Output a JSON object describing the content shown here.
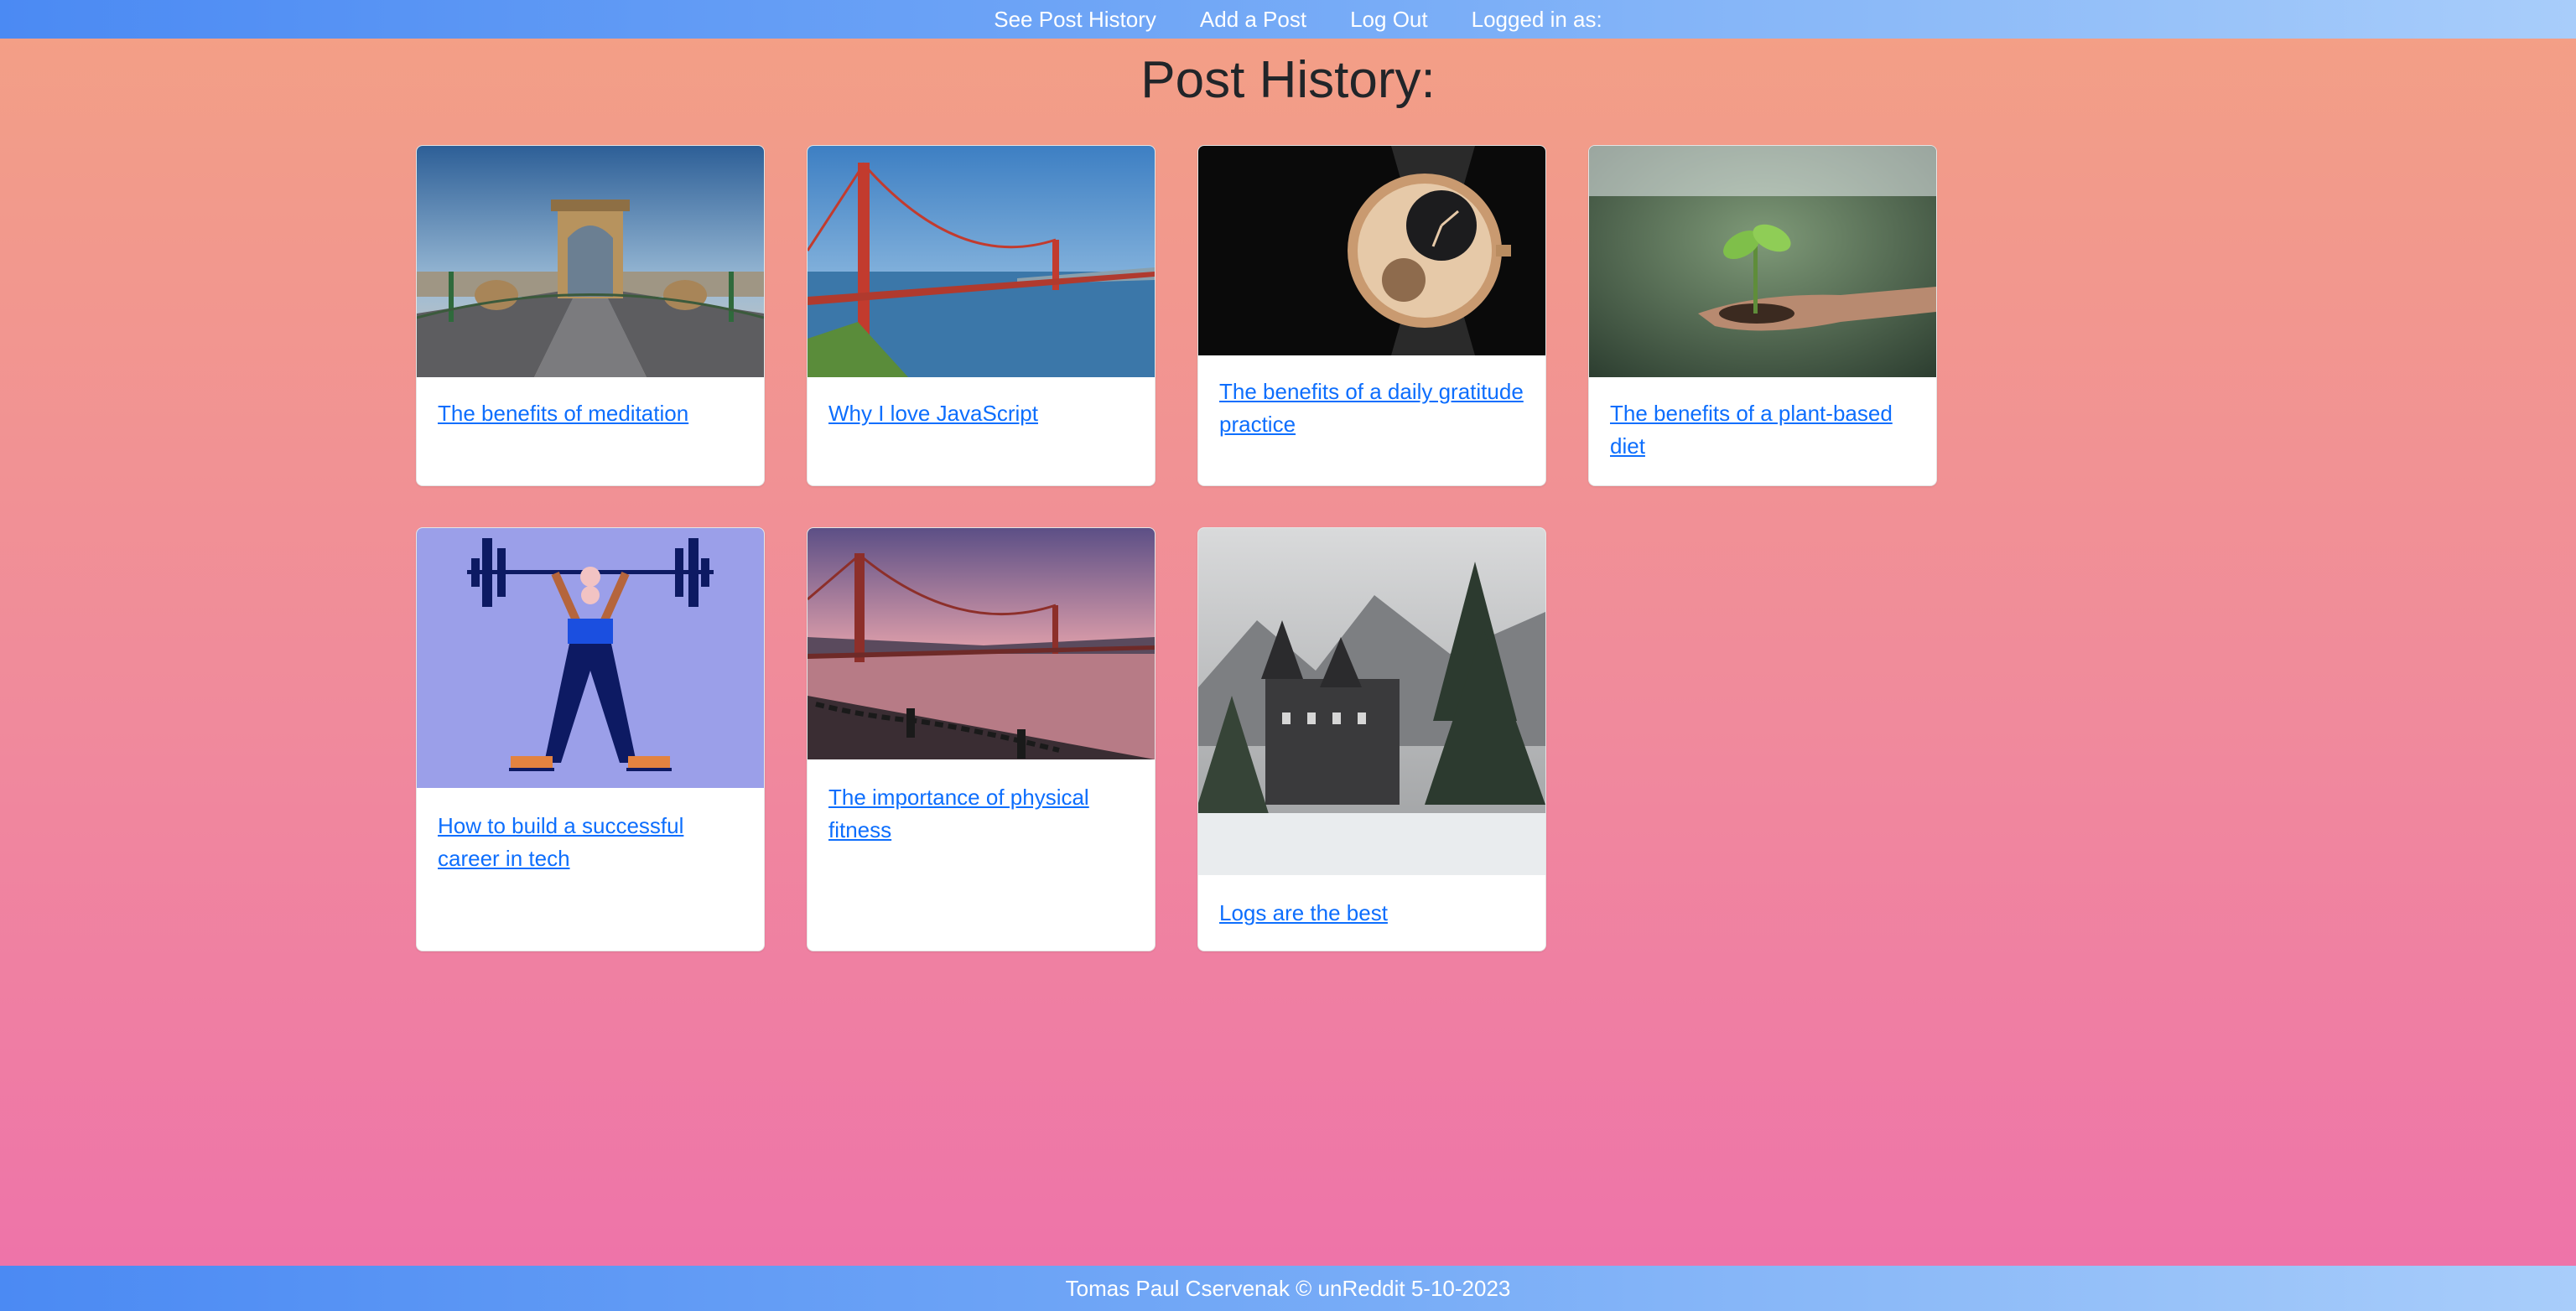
{
  "nav": {
    "history_label": "See Post History",
    "add_label": "Add a Post",
    "logout_label": "Log Out",
    "logged_in_label": "Logged in as:"
  },
  "page": {
    "title": "Post History:"
  },
  "posts": [
    {
      "title": "The benefits of meditation",
      "image": "chain-bridge-photo"
    },
    {
      "title": "Why I love JavaScript",
      "image": "golden-gate-bridge-photo"
    },
    {
      "title": "The benefits of a daily gratitude practice",
      "image": "wristwatch-photo"
    },
    {
      "title": "The benefits of a plant-based diet",
      "image": "seedling-in-hand-photo"
    },
    {
      "title": "How to build a successful career in tech",
      "image": "weightlifter-illustration"
    },
    {
      "title": "The importance of physical fitness",
      "image": "golden-gate-sunset-photo"
    },
    {
      "title": "Logs are the best",
      "image": "snowy-castle-photo"
    }
  ],
  "footer": {
    "text": "Tomas Paul Cservenak © unReddit 5-10-2023"
  }
}
